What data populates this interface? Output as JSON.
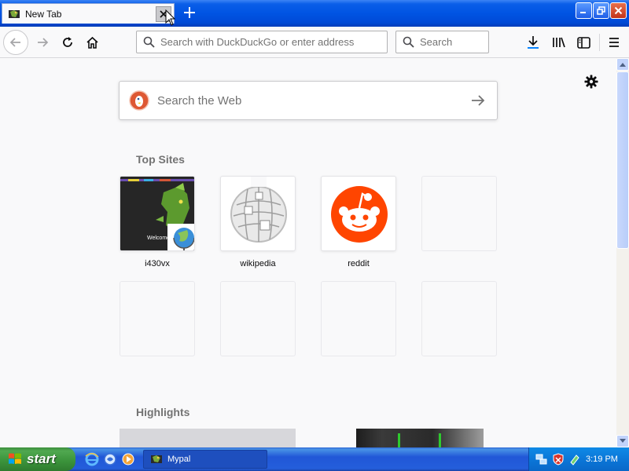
{
  "tab": {
    "title": "New Tab"
  },
  "navbar": {
    "url_placeholder": "Search with DuckDuckGo or enter address",
    "search_placeholder": "Search"
  },
  "newtab": {
    "websearch_placeholder": "Search the Web",
    "top_sites_heading": "Top Sites",
    "highlights_heading": "Highlights",
    "top_sites": [
      {
        "label": "i430vx",
        "icon": "i430vx-thumbnail"
      },
      {
        "label": "wikipedia",
        "icon": "wikipedia-globe-icon"
      },
      {
        "label": "reddit",
        "icon": "reddit-alien-icon"
      }
    ]
  },
  "tile_mark": {
    "welcome": "Welcome"
  },
  "taskbar": {
    "start_label": "start",
    "task_item": "Mypal",
    "clock": "3:19 PM"
  },
  "colors": {
    "reddit_orange": "#ff4500",
    "ddg_orange": "#de5833",
    "xp_blue": "#0054e3",
    "xp_green": "#3a923a"
  }
}
